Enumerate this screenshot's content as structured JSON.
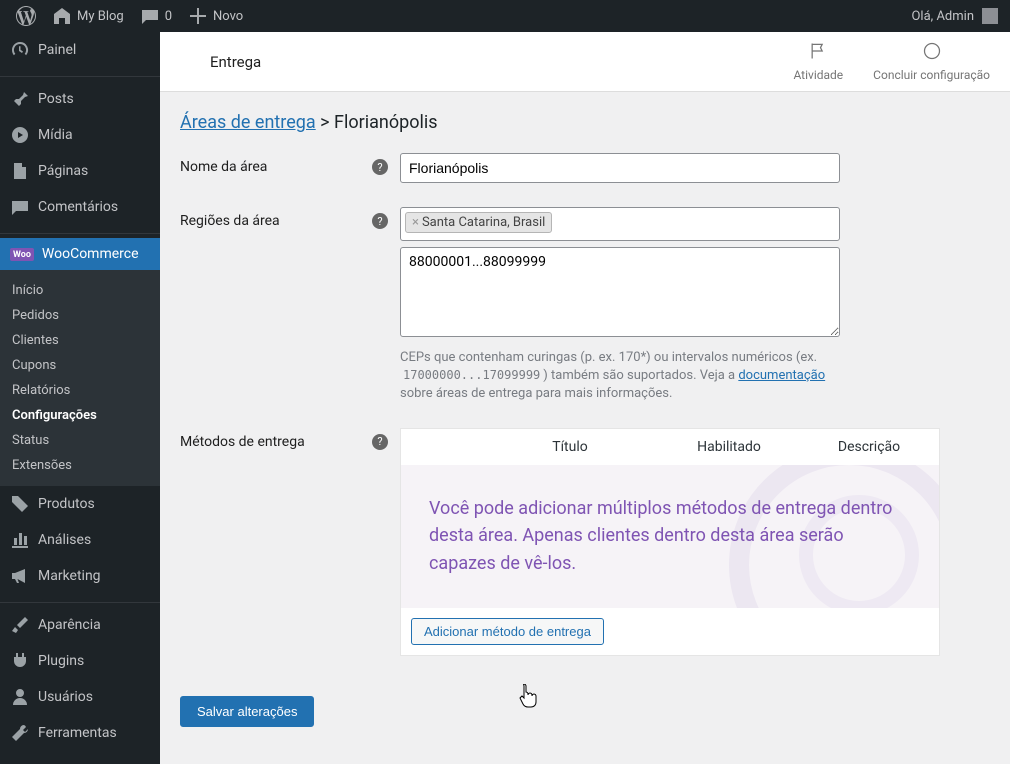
{
  "adminbar": {
    "site_name": "My Blog",
    "comments_count": "0",
    "new_label": "Novo",
    "greeting": "Olá, Admin"
  },
  "sidebar": {
    "dashboard": "Painel",
    "posts": "Posts",
    "media": "Mídia",
    "pages": "Páginas",
    "comments": "Comentários",
    "woocommerce": "WooCommerce",
    "submenu": {
      "home": "Início",
      "orders": "Pedidos",
      "customers": "Clientes",
      "coupons": "Cupons",
      "reports": "Relatórios",
      "settings": "Configurações",
      "status": "Status",
      "extensions": "Extensões"
    },
    "products": "Produtos",
    "analytics": "Análises",
    "marketing": "Marketing",
    "appearance": "Aparência",
    "plugins": "Plugins",
    "users": "Usuários",
    "tools": "Ferramentas"
  },
  "header": {
    "title": "Entrega",
    "activity": "Atividade",
    "finish_setup": "Concluir configuração"
  },
  "breadcrumb": {
    "zones_link": "Áreas de entrega",
    "sep": " > ",
    "current": "Florianópolis"
  },
  "form": {
    "zone_name_label": "Nome da área",
    "zone_name_value": "Florianópolis",
    "zone_regions_label": "Regiões da área",
    "region_tag": "Santa Catarina, Brasil",
    "postcodes_value": "88000001...88099999",
    "hint_prefix": "CEPs que contenham curingas (p. ex. 170*) ou intervalos numéricos (ex. ",
    "hint_code": "17000000...17099999",
    "hint_mid": ") também são suportados. Veja a ",
    "hint_link": "documentação",
    "hint_suffix": " sobre áreas de entrega para mais informações.",
    "methods_label": "Métodos de entrega",
    "table": {
      "col_title": "Título",
      "col_enabled": "Habilitado",
      "col_desc": "Descrição"
    },
    "empty_message": "Você pode adicionar múltiplos métodos de entrega dentro desta área. Apenas clientes dentro desta área serão capazes de vê-los.",
    "add_method_btn": "Adicionar método de entrega",
    "save_btn": "Salvar alterações"
  }
}
